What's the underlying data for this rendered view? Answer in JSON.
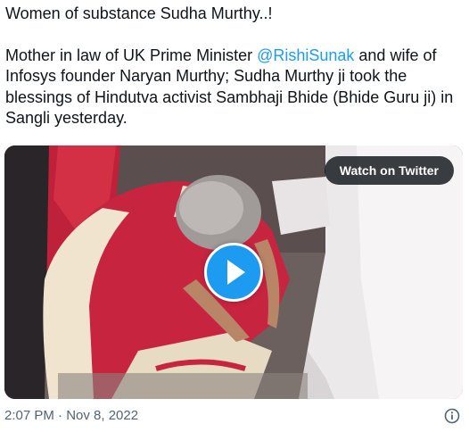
{
  "tweet": {
    "line1": "Women of substance Sudha Murthy..!",
    "para_before_mention": "Mother in law of UK Prime Minister ",
    "mention": "@RishiSunak",
    "para_after_mention": " and wife of Infosys founder Naryan Murthy; Sudha Murthy ji took the blessings of Hindutva activist Sambhaji Bhide (Bhide Guru ji) in Sangli yesterday."
  },
  "media": {
    "watch_label": "Watch on Twitter",
    "play_icon": "play-icon"
  },
  "meta": {
    "timestamp": "2:07 PM · Nov 8, 2022",
    "info_icon": "info-icon"
  },
  "colors": {
    "link": "#1d9bf0",
    "text": "#0f1419",
    "secondary": "#536471",
    "play_button": "#1d9bf0"
  }
}
